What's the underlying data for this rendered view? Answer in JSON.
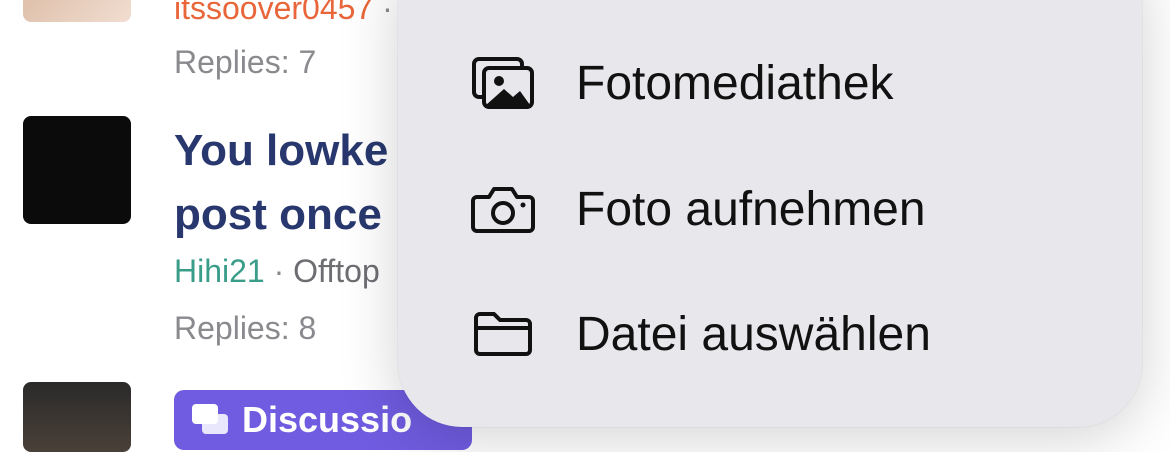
{
  "threads": [
    {
      "author": "itssoover0457",
      "separator": "·",
      "category": "",
      "replies": "Replies: 7"
    },
    {
      "title_line1": "You lowke",
      "title_line2": "post once",
      "author": "Hihi21",
      "separator": "·",
      "category": "Offtop",
      "replies": "Replies: 8"
    },
    {
      "badge_label": "Discussio"
    }
  ],
  "menu": {
    "items": [
      {
        "label": "Fotomediathek",
        "icon": "photo-library-icon"
      },
      {
        "label": "Foto aufnehmen",
        "icon": "camera-icon"
      },
      {
        "label": "Datei auswählen",
        "icon": "folder-icon"
      }
    ]
  },
  "colors": {
    "title": "#28386e",
    "author_orange": "#e8663a",
    "author_teal": "#3a9d8a",
    "badge": "#6f5ce0",
    "menu_bg": "#e8e7ec"
  }
}
